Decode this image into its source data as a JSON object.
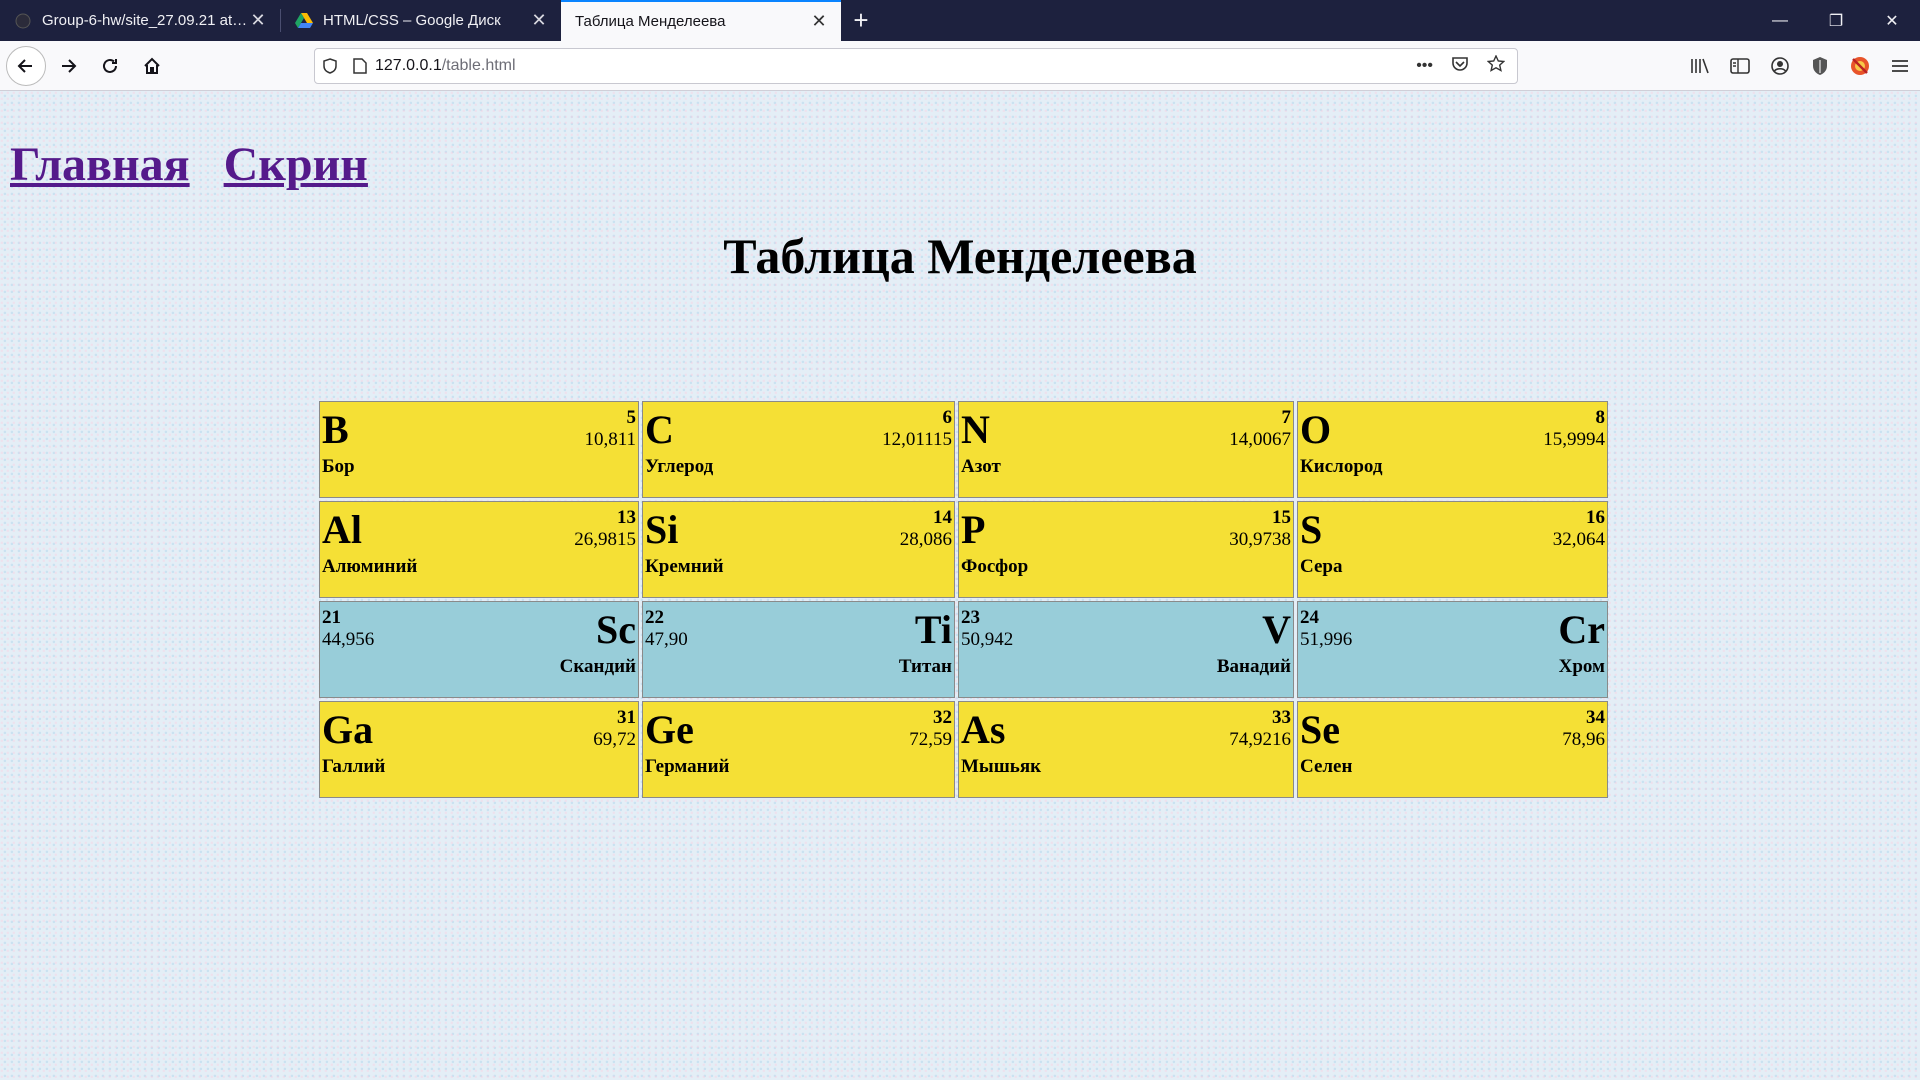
{
  "browser": {
    "tabs": [
      {
        "title": "Group-6-hw/site_27.09.21 at m",
        "icon": "github-icon"
      },
      {
        "title": "HTML/CSS – Google Диск",
        "icon": "google-drive-icon"
      },
      {
        "title": "Таблица Менделеева",
        "icon": "page-icon"
      }
    ],
    "url_host": "127.0.0.1",
    "url_path": "/table.html"
  },
  "page": {
    "links": [
      "Главная",
      "Скрин"
    ],
    "title": "Таблица Менделеева"
  },
  "table": {
    "rows": [
      [
        {
          "symbol": "B",
          "number": "5",
          "mass": "10,811",
          "name": "Бор",
          "color": "#f5e035"
        },
        {
          "symbol": "C",
          "number": "6",
          "mass": "12,01115",
          "name": "Углерод",
          "color": "#f5e035"
        },
        {
          "symbol": "N",
          "number": "7",
          "mass": "14,0067",
          "name": "Азот",
          "color": "#f5e035"
        },
        {
          "symbol": "O",
          "number": "8",
          "mass": "15,9994",
          "name": "Кислород",
          "color": "#f5e035"
        }
      ],
      [
        {
          "symbol": "Al",
          "number": "13",
          "mass": "26,9815",
          "name": "Алюминий",
          "color": "#f5e035"
        },
        {
          "symbol": "Si",
          "number": "14",
          "mass": "28,086",
          "name": "Кремний",
          "color": "#f5e035"
        },
        {
          "symbol": "P",
          "number": "15",
          "mass": "30,9738",
          "name": "Фосфор",
          "color": "#f5e035"
        },
        {
          "symbol": "S",
          "number": "16",
          "mass": "32,064",
          "name": "Сера",
          "color": "#f5e035"
        }
      ],
      [
        {
          "symbol": "Sc",
          "number": "21",
          "mass": "44,956",
          "name": "Скандий",
          "color": "#98cdd9"
        },
        {
          "symbol": "Ti",
          "number": "22",
          "mass": "47,90",
          "name": "Титан",
          "color": "#98cdd9"
        },
        {
          "symbol": "V",
          "number": "23",
          "mass": "50,942",
          "name": "Ванадий",
          "color": "#98cdd9"
        },
        {
          "symbol": "Cr",
          "number": "24",
          "mass": "51,996",
          "name": "Хром",
          "color": "#98cdd9"
        }
      ],
      [
        {
          "symbol": "Ga",
          "number": "31",
          "mass": "69,72",
          "name": "Галлий",
          "color": "#f5e035"
        },
        {
          "symbol": "Ge",
          "number": "32",
          "mass": "72,59",
          "name": "Германий",
          "color": "#f5e035"
        },
        {
          "symbol": "As",
          "number": "33",
          "mass": "74,9216",
          "name": "Мышьяк",
          "color": "#f5e035"
        },
        {
          "symbol": "Se",
          "number": "34",
          "mass": "78,96",
          "name": "Селен",
          "color": "#f5e035"
        }
      ]
    ]
  }
}
